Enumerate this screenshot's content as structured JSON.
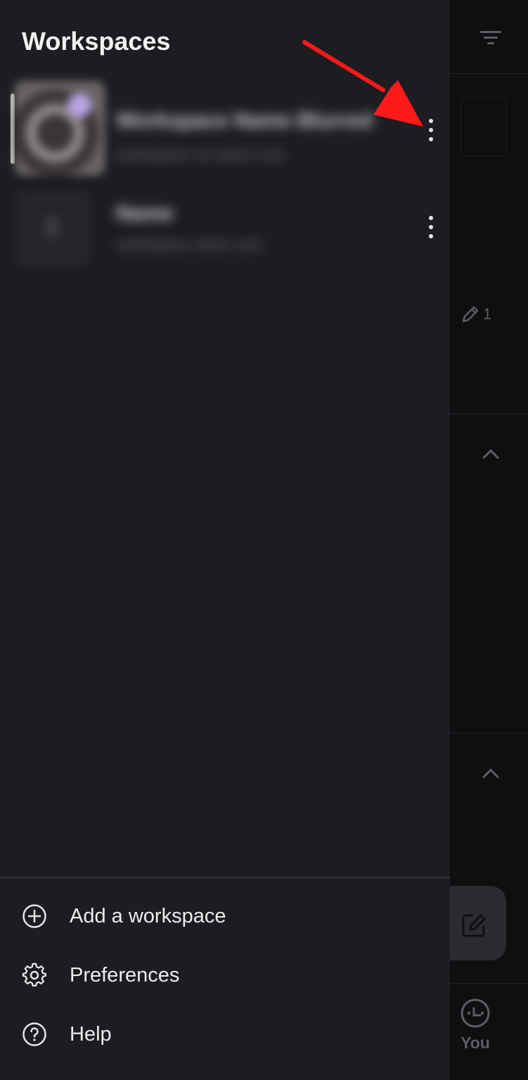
{
  "drawer": {
    "title": "Workspaces",
    "workspaces": [
      {
        "name": "Workspace Name Blurred",
        "subtitle": "workspace-url.slack.com",
        "active": true
      },
      {
        "name": "Name",
        "subtitle": "workspace.slack.com",
        "active": false
      }
    ],
    "menu": [
      {
        "label": "Add a workspace",
        "icon": "plus-circle-icon"
      },
      {
        "label": "Preferences",
        "icon": "gear-icon"
      },
      {
        "label": "Help",
        "icon": "help-circle-icon"
      }
    ]
  },
  "background": {
    "pencil_count": "1",
    "you_label": "You"
  },
  "colors": {
    "drawer_bg": "#1b1d21",
    "annotation_arrow": "#ff1a1a"
  }
}
